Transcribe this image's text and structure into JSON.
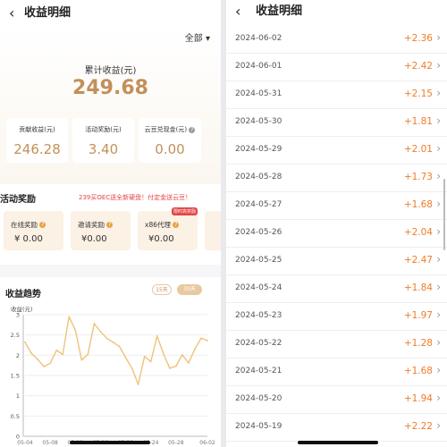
{
  "left": {
    "back_icon": "chevron-left-icon",
    "title": "收益明细",
    "filter_label": "全部",
    "summary": {
      "label": "累计收益(元)",
      "value": "249.68"
    },
    "stats": [
      {
        "label": "贡献收益(元)",
        "value": "246.28",
        "help": false
      },
      {
        "label": "活动奖励(元)",
        "value": "3.40",
        "help": false
      },
      {
        "label": "云豆兑现金(元)",
        "value": "0.00",
        "help": true
      }
    ],
    "activity": {
      "title": "活动奖励",
      "banner": "239买OEC送全新硬盘！付定金送云豆！",
      "cards": [
        {
          "label": "在线奖励",
          "value": "¥ 0.00",
          "badge": ""
        },
        {
          "label": "邀请奖励",
          "value": "¥0.00",
          "badge": ""
        },
        {
          "label": "x86代理",
          "value": "¥0.00",
          "badge": "限时高奖励"
        }
      ]
    },
    "trend": {
      "title": "收益趋势",
      "tabs": [
        {
          "label": "15天",
          "active": false
        },
        {
          "label": "30天",
          "active": true
        }
      ],
      "unit_label": "收益(元)"
    }
  },
  "right": {
    "back_icon": "chevron-left-icon",
    "title": "收益明细",
    "rows": [
      {
        "date": "2024-06-02",
        "amount": "+2.36"
      },
      {
        "date": "2024-06-01",
        "amount": "+2.42"
      },
      {
        "date": "2024-05-31",
        "amount": "+2.15"
      },
      {
        "date": "2024-05-30",
        "amount": "+1.81"
      },
      {
        "date": "2024-05-29",
        "amount": "+2.01"
      },
      {
        "date": "2024-05-28",
        "amount": "+1.73"
      },
      {
        "date": "2024-05-27",
        "amount": "+1.68"
      },
      {
        "date": "2024-05-26",
        "amount": "+2.04"
      },
      {
        "date": "2024-05-25",
        "amount": "+2.47"
      },
      {
        "date": "2024-05-24",
        "amount": "+1.84"
      },
      {
        "date": "2024-05-23",
        "amount": "+1.97"
      },
      {
        "date": "2024-05-22",
        "amount": "+1.28"
      },
      {
        "date": "2024-05-21",
        "amount": "+1.68"
      },
      {
        "date": "2024-05-20",
        "amount": "+1.94"
      },
      {
        "date": "2024-05-19",
        "amount": "+2.22"
      }
    ]
  },
  "colors": {
    "gold": "#c2905a",
    "orange": "#f07c2a",
    "red": "#e34545",
    "line": "#f0c27a"
  },
  "chart_data": {
    "type": "line",
    "y_ticks": [
      "0",
      "0.5",
      "1",
      "1.5",
      "2",
      "2.5",
      "3"
    ],
    "ylim": [
      0,
      3
    ],
    "x_tick_labels": [
      "05-04",
      "05-08",
      "05-12",
      "05-16",
      "05-20",
      "05-24",
      "05-28",
      "06-02"
    ],
    "x": [
      "05-04",
      "05-05",
      "05-06",
      "05-07",
      "05-08",
      "05-09",
      "05-10",
      "05-11",
      "05-12",
      "05-13",
      "05-14",
      "05-15",
      "05-16",
      "05-17",
      "05-18",
      "05-19",
      "05-20",
      "05-21",
      "05-22",
      "05-23",
      "05-24",
      "05-25",
      "05-26",
      "05-27",
      "05-28",
      "05-29",
      "05-30",
      "05-31",
      "06-01",
      "06-02"
    ],
    "values": [
      2.32,
      2.05,
      1.9,
      1.72,
      1.8,
      2.12,
      2.02,
      2.95,
      2.62,
      1.88,
      2.02,
      2.78,
      2.58,
      2.42,
      2.32,
      2.22,
      1.94,
      1.68,
      1.28,
      1.97,
      1.84,
      2.47,
      2.04,
      1.68,
      1.73,
      2.01,
      1.81,
      2.15,
      2.42,
      2.36
    ]
  }
}
